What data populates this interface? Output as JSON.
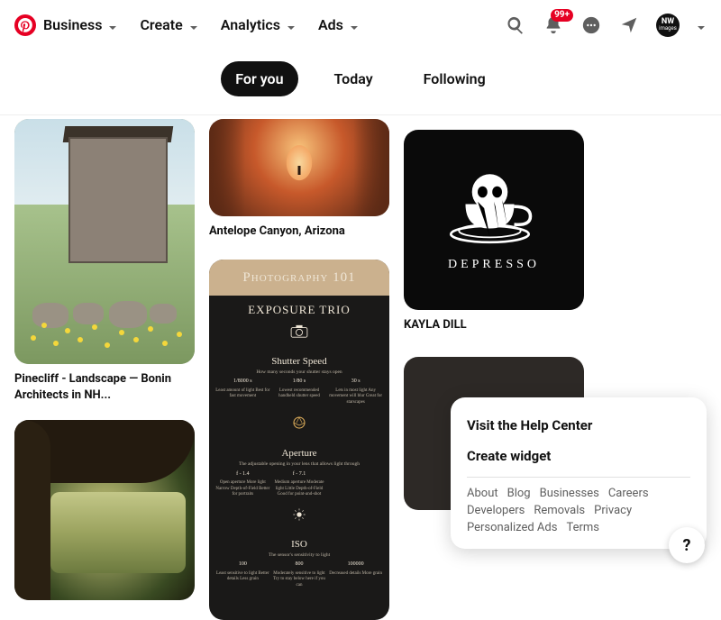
{
  "nav": {
    "items": [
      "Business",
      "Create",
      "Analytics",
      "Ads"
    ],
    "badge": "99+",
    "avatar_line1": "NW",
    "avatar_line2": "images"
  },
  "tabs": {
    "items": [
      "For you",
      "Today",
      "Following"
    ],
    "active_index": 0
  },
  "pins": {
    "house": {
      "title": "Pinecliff - Landscape — Bonin Architects in NH..."
    },
    "canyon": {
      "title": "Antelope Canyon, Arizona"
    },
    "depresso": {
      "title": "KAYLA DILL",
      "word": "DEPRESSO"
    },
    "photo101": {
      "header": "Photography 101",
      "sub": "EXPOSURE TRIO",
      "sec1": "Shutter Speed",
      "sec1_cap": "How many seconds your shutter stays open",
      "sec1_vals": [
        "1/8000 s",
        "1/80 s",
        "30 s"
      ],
      "sec1_col1": "Least amount of light\nBest for fast\nmovement",
      "sec1_col2": "Lowest recommended\nhandheld shutter speed",
      "sec1_col3": "Lets in most light\nAny movement will blur\nGreat for starscapes",
      "sec2": "Aperture",
      "sec2_cap": "The adjustable opening in your lens that allows light through",
      "sec2_vals": [
        "f - 1.4",
        "f - 7.1",
        ""
      ],
      "sec2_col1": "Open aperture\nMore light\nNarrow Depth-of-Field\nBetter for portraits",
      "sec2_col2": "Medium aperture\nModerate light\nLittle Depth-of-Field\nGood for point-and-shot",
      "sec2_col3": "",
      "sec3": "ISO",
      "sec3_cap": "The sensor's sensitivity to light",
      "sec3_vals": [
        "100",
        "800",
        "100000"
      ],
      "sec3_col1": "Least sensitive to light\nBetter details\nLess grain",
      "sec3_col2": "Moderately sensitive to light\nTry to stay below here if you can",
      "sec3_col3": "Decreased details\nMore grain"
    }
  },
  "menu": {
    "primary": [
      "Visit the Help Center",
      "Create widget"
    ],
    "links": [
      "About",
      "Blog",
      "Businesses",
      "Careers",
      "Developers",
      "Removals",
      "Privacy",
      "Personalized Ads",
      "Terms"
    ]
  },
  "help_fab": "?"
}
